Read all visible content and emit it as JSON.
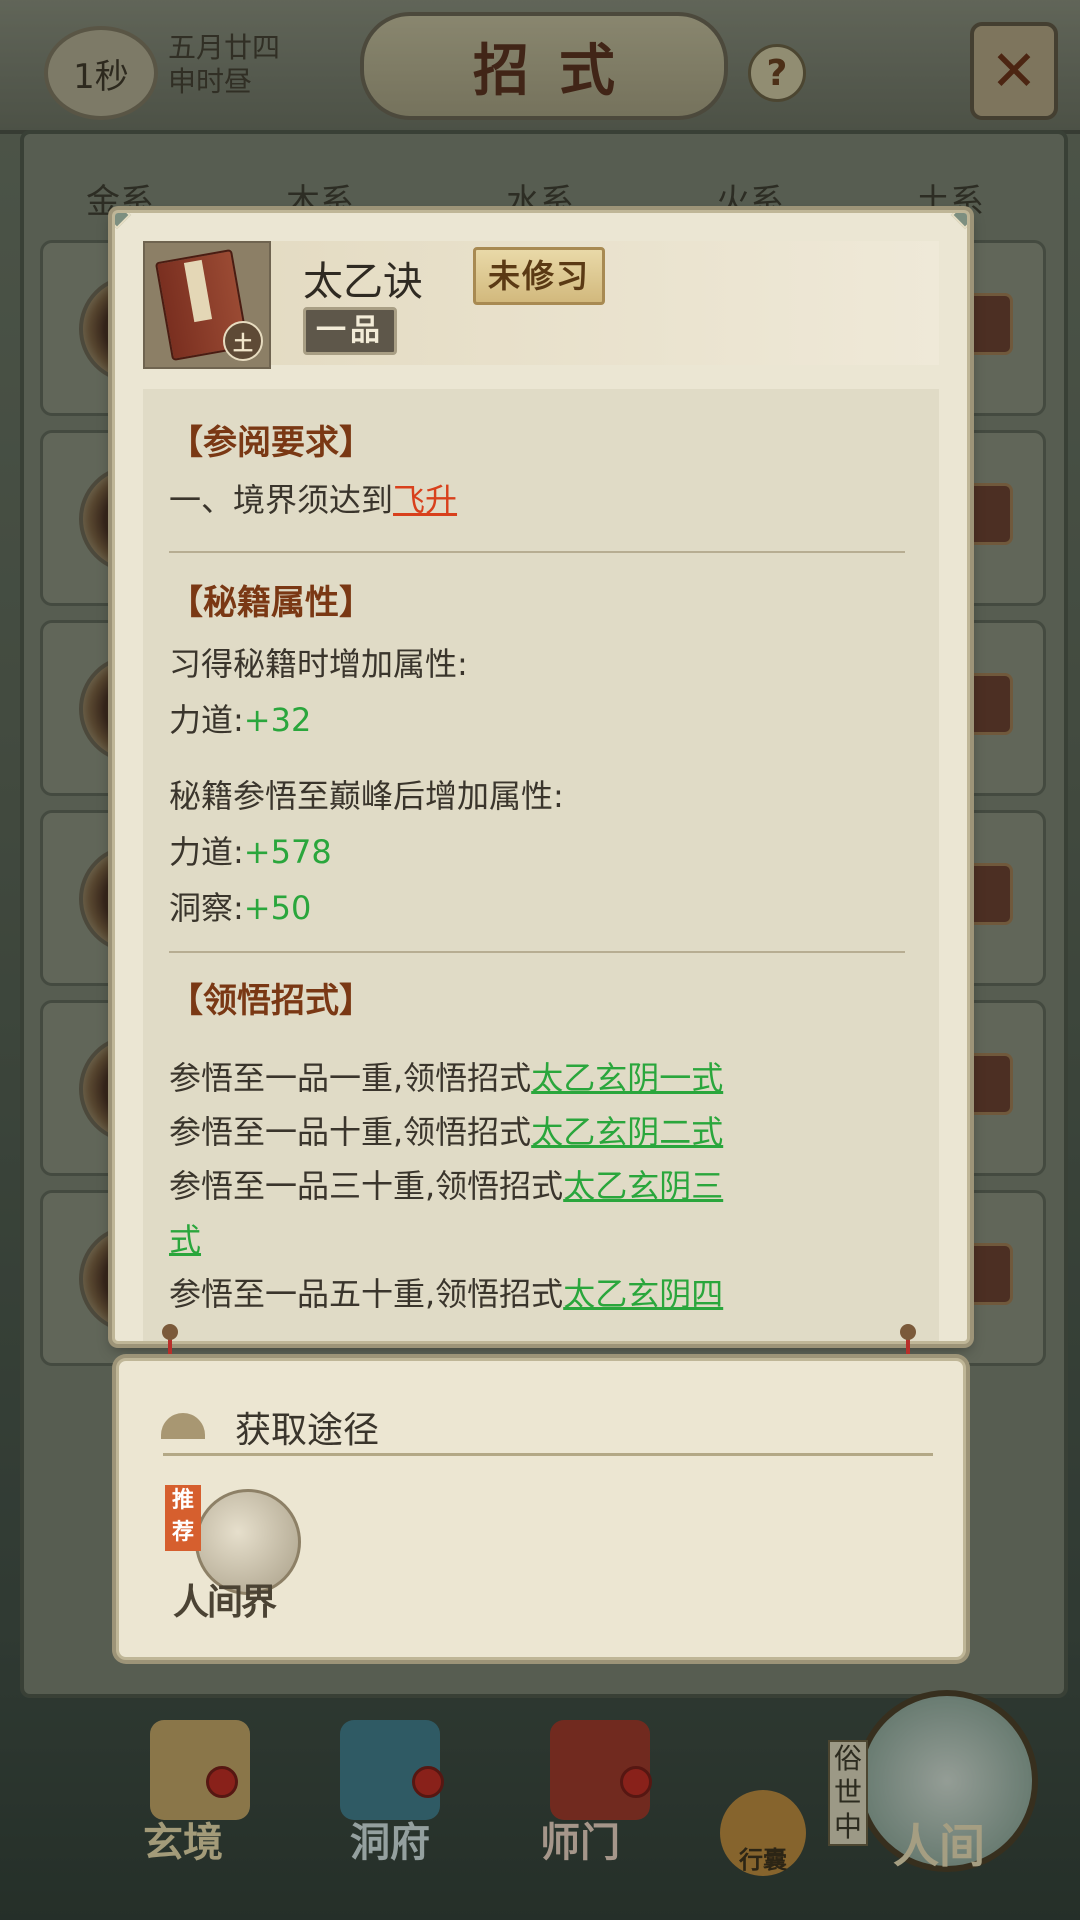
{
  "topbar": {
    "timer": "1秒",
    "date_line1": "五月廿四",
    "date_line2": "申时昼",
    "title": "招式",
    "help_symbol": "?",
    "close_symbol": "✕"
  },
  "tabs": [
    "金系",
    "木系",
    "水系",
    "火系",
    "土系"
  ],
  "skill": {
    "name": "太乙诀",
    "status": "未修习",
    "grade": "一品",
    "element": "土"
  },
  "requirements": {
    "title": "【参阅要求】",
    "line_prefix": "一、境界须达到",
    "realm": "飞升"
  },
  "attributes": {
    "title": "【秘籍属性】",
    "learn_header": "习得秘籍时增加属性:",
    "learn_stats": [
      {
        "name": "力道:",
        "value": "+32"
      }
    ],
    "peak_header": "秘籍参悟至巅峰后增加属性:",
    "peak_stats": [
      {
        "name": "力道:",
        "value": "+578"
      },
      {
        "name": "洞察:",
        "value": "+50"
      }
    ]
  },
  "moves": {
    "title": "【领悟招式】",
    "items": [
      {
        "text": "参悟至一品一重,领悟招式",
        "move": "太乙玄阴一式"
      },
      {
        "text": "参悟至一品十重,领悟招式",
        "move": "太乙玄阴二式"
      },
      {
        "text": "参悟至一品三十重,领悟招式",
        "move": "太乙玄阴三",
        "move_cont": "式"
      },
      {
        "text": "参悟至一品五十重,领悟招式",
        "move": "太乙玄阴四"
      }
    ]
  },
  "acquisition": {
    "title": "获取途径",
    "sources": [
      {
        "name": "人间界",
        "badge": "推荐"
      }
    ]
  },
  "bottom_nav": {
    "items": [
      "玄境",
      "洞府",
      "师门",
      "行囊",
      "人间"
    ],
    "side_label": "俗世中"
  },
  "colors": {
    "accent_brown": "#7a3814",
    "green_value": "#2aa63c",
    "red_link": "#d8401c"
  }
}
